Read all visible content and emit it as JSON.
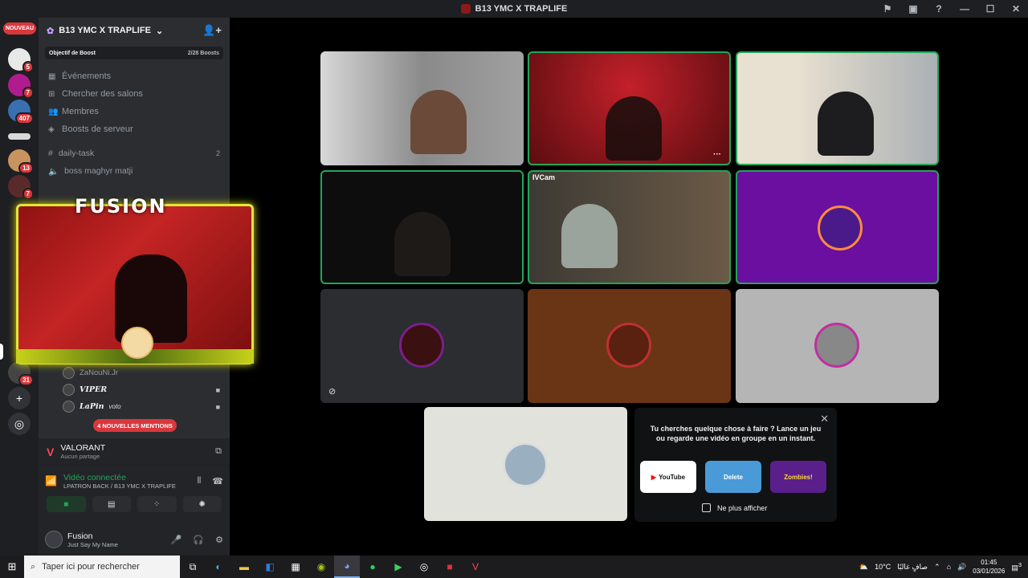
{
  "window": {
    "title": "B13 YMC X TRAPLIFE"
  },
  "guilds": {
    "nouveau_label": "NOUVEAU",
    "badges": [
      "5",
      "7",
      "407",
      "13",
      "7",
      "31"
    ]
  },
  "server": {
    "name": "B13 YMC X TRAPLIFE",
    "boost_goal_label": "Objectif de Boost",
    "boost_count": "2/28 Boosts",
    "nav": [
      "Événements",
      "Chercher des salons",
      "Membres",
      "Boosts de serveur"
    ],
    "channels": [
      {
        "name": "daily-task",
        "count": "2"
      },
      {
        "name": "boss maghyr matji",
        "count": ""
      }
    ]
  },
  "overlay": {
    "title": "FUSION"
  },
  "voice_members": [
    {
      "name": "ZaNouNi.Jr",
      "styled": false,
      "cam": false,
      "extra": ""
    },
    {
      "name": "VIPER",
      "styled": true,
      "cam": true,
      "extra": ""
    },
    {
      "name": "LaPin",
      "styled": true,
      "cam": true,
      "extra": "voto"
    }
  ],
  "mentions_label": "4 NOUVELLES MENTIONS",
  "activity": {
    "title": "VALORANT",
    "subtitle": "Aucun partage"
  },
  "voice": {
    "status": "Vidéo connectée",
    "channel": "LPATRON BACK / B13 YMC X TRAPLIFE"
  },
  "user": {
    "name": "Fusion",
    "status": "Just Say My Name"
  },
  "promo": {
    "message": "Tu cherches quelque chose à faire ? Lance un jeu ou regarde une vidéo en groupe en un instant.",
    "apps": [
      "YouTube",
      "Delete",
      "Zombies!"
    ],
    "checkbox_label": "Ne plus afficher"
  },
  "tiles": {
    "cam_label": "IVCam"
  },
  "taskbar": {
    "search_placeholder": "Taper ici pour rechercher",
    "weather": "10°C",
    "weather_desc": "صافٍ غالبًا",
    "time": "01:45",
    "date": "03/01/2026",
    "notif_count": "3"
  },
  "colors": {
    "speaking": "#23a55a",
    "mention": "#da373c",
    "accent": "#e2e63a"
  }
}
